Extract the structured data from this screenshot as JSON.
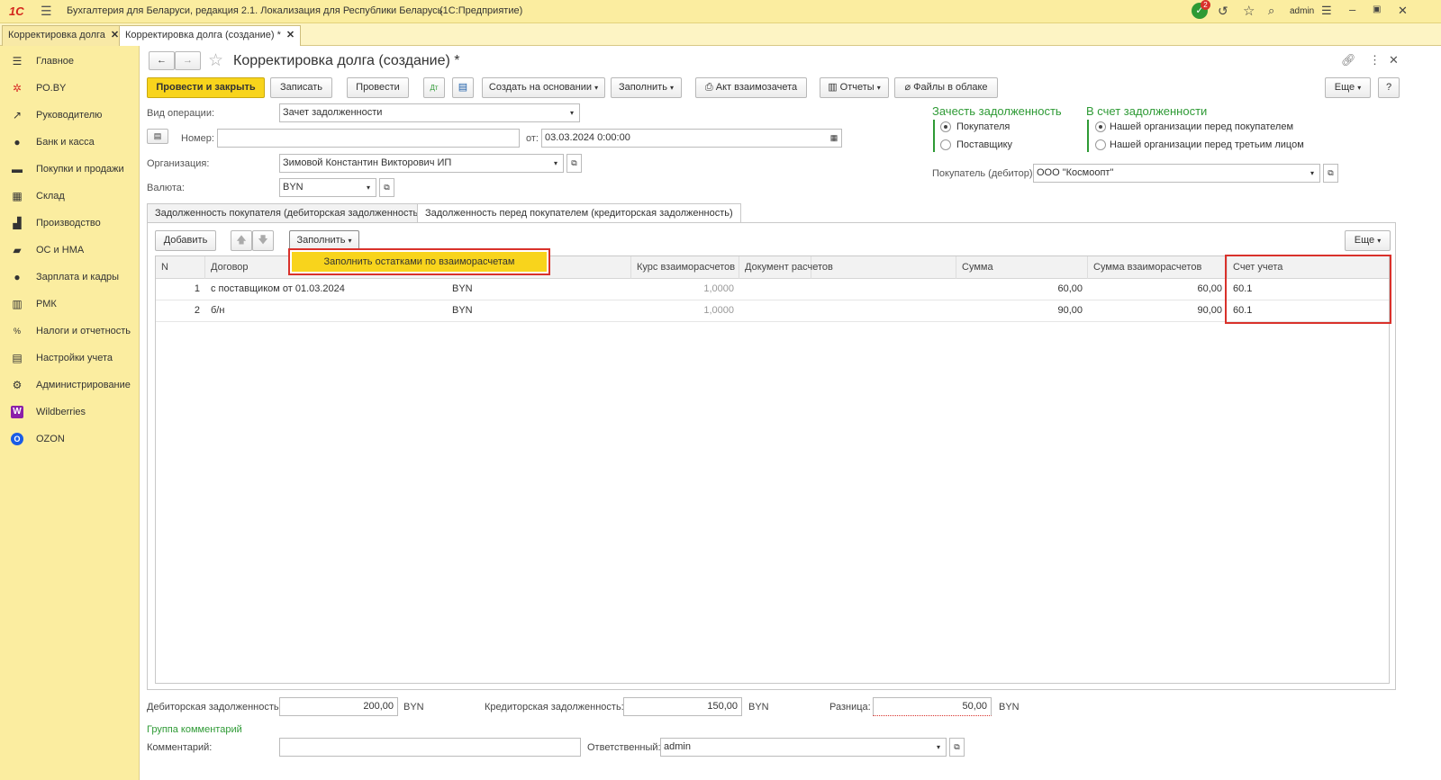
{
  "app": {
    "logo": "1С",
    "title": "Бухгалтерия для Беларуси, редакция 2.1. Локализация для Республики Беларусь",
    "platform": "(1С:Предприятие)",
    "notifications_count": "2",
    "user": "admin"
  },
  "window_tabs": [
    {
      "label": "Корректировка долга"
    },
    {
      "label": "Корректировка долга (создание) *"
    }
  ],
  "sidebar": {
    "items": [
      {
        "label": "Главное",
        "icon": "menu-icon"
      },
      {
        "label": "РО.BY",
        "icon": "ro-icon"
      },
      {
        "label": "Руководителю",
        "icon": "chart-icon"
      },
      {
        "label": "Банк и касса",
        "icon": "bank-icon"
      },
      {
        "label": "Покупки и продажи",
        "icon": "cart-icon"
      },
      {
        "label": "Склад",
        "icon": "warehouse-icon"
      },
      {
        "label": "Производство",
        "icon": "factory-icon"
      },
      {
        "label": "ОС и НМА",
        "icon": "truck-icon"
      },
      {
        "label": "Зарплата и кадры",
        "icon": "person-icon"
      },
      {
        "label": "РМК",
        "icon": "register-icon"
      },
      {
        "label": "Налоги и отчетность",
        "icon": "tax-icon"
      },
      {
        "label": "Настройки учета",
        "icon": "book-icon"
      },
      {
        "label": "Администрирование",
        "icon": "gear-icon"
      },
      {
        "label": "Wildberries",
        "icon": "wildberries-icon"
      },
      {
        "label": "OZON",
        "icon": "ozon-icon"
      }
    ]
  },
  "form": {
    "title": "Корректировка долга (создание) *",
    "toolbar": {
      "post_close": "Провести и закрыть",
      "save": "Записать",
      "post": "Провести",
      "create_based": "Создать на основании",
      "fill": "Заполнить",
      "act": "Акт взаимозачета",
      "reports": "Отчеты",
      "files": "Файлы в облаке",
      "more": "Еще",
      "help": "?"
    },
    "operation_label": "Вид операции:",
    "operation_value": "Зачет задолженности",
    "number_label": "Номер:",
    "number_value": "",
    "date_label": "от:",
    "date_value": "03.03.2024  0:00:00",
    "org_label": "Организация:",
    "org_value": "Зимовой Константин Викторович ИП",
    "currency_label": "Валюта:",
    "currency_value": "BYN",
    "offset_debt": {
      "title": "Зачесть задолженность",
      "options": [
        "Покупателя",
        "Поставщику"
      ]
    },
    "into_debt": {
      "title": "В счет задолженности",
      "options": [
        "Нашей организации перед покупателем",
        "Нашей организации перед третьим лицом"
      ]
    },
    "buyer_label": "Покупатель (дебитор):",
    "buyer_value": "ООО \"Космоопт\"",
    "tabs": [
      "Задолженность покупателя (дебиторская задолженность)",
      "Задолженность перед покупателем (кредиторская задолженность)"
    ],
    "table_toolbar": {
      "add": "Добавить",
      "fill": "Заполнить",
      "more": "Еще"
    },
    "fill_menu": {
      "item": "Заполнить остатками по взаиморасчетам"
    },
    "table": {
      "columns": [
        "N",
        "Договор",
        "",
        "Курс взаиморасчетов",
        "Документ расчетов",
        "Сумма",
        "Сумма взаиморасчетов",
        "Счет учета"
      ],
      "rows": [
        {
          "n": "1",
          "contract": "с поставщиком от 01.03.2024",
          "currency": "BYN",
          "rate": "1,0000",
          "doc": "",
          "sum": "60,00",
          "sum_settle": "60,00",
          "account": "60.1"
        },
        {
          "n": "2",
          "contract": "б/н",
          "currency": "BYN",
          "rate": "1,0000",
          "doc": "",
          "sum": "90,00",
          "sum_settle": "90,00",
          "account": "60.1"
        }
      ]
    },
    "footer": {
      "debit_label": "Дебиторская задолженность:",
      "debit_value": "200,00",
      "credit_label": "Кредиторская задолженность:",
      "credit_value": "150,00",
      "diff_label": "Разница:",
      "diff_value": "50,00",
      "currency": "BYN",
      "comment_group": "Группа комментарий",
      "comment_label": "Комментарий:",
      "comment_value": "",
      "responsible_label": "Ответственный:",
      "responsible_value": "admin"
    }
  },
  "colors": {
    "sidebar_bg": "#fbeda0",
    "accent_yellow": "#f8d41c",
    "green_heading": "#2e9a35",
    "highlight_red": "#d9312b"
  }
}
